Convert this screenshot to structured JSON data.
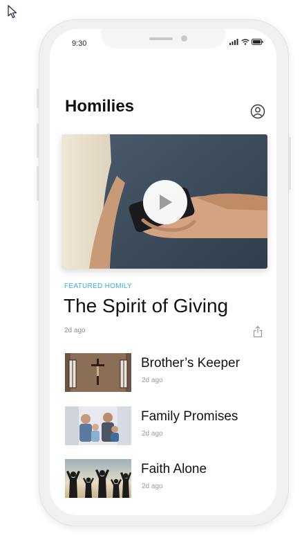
{
  "status_bar": {
    "time": "9:30",
    "icons": [
      "signal-icon",
      "wifi-icon",
      "battery-icon"
    ]
  },
  "header": {
    "title": "Homilies",
    "profile_icon": "profile-icon"
  },
  "featured": {
    "label": "FEATURED HOMILY",
    "title": "The Spirit of Giving",
    "age": "2d ago",
    "play_icon": "play-icon",
    "share_icon": "share-icon"
  },
  "list": [
    {
      "title": "Brother’s Keeper",
      "age": "2d ago"
    },
    {
      "title": "Family Promises",
      "age": "2d ago"
    },
    {
      "title": "Faith Alone",
      "age": "2d ago"
    }
  ],
  "colors": {
    "accent": "#3aaed6",
    "text": "#111111",
    "muted": "#8a8a8e"
  }
}
